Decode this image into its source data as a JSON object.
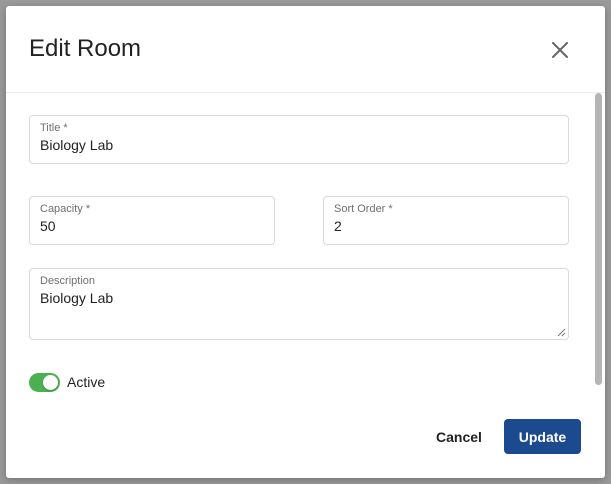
{
  "dialog": {
    "title": "Edit Room",
    "close_icon": "close-icon"
  },
  "form": {
    "title": {
      "label": "Title *",
      "value": "Biology Lab"
    },
    "capacity": {
      "label": "Capacity *",
      "value": "50"
    },
    "sort_order": {
      "label": "Sort Order *",
      "value": "2"
    },
    "description": {
      "label": "Description",
      "value": "Biology Lab"
    },
    "active": {
      "label": "Active",
      "checked": true
    }
  },
  "actions": {
    "cancel_label": "Cancel",
    "update_label": "Update"
  },
  "colors": {
    "primary": "#1b4a8f",
    "toggle_on": "#4caf50",
    "overlay": "#9a9a9a"
  }
}
